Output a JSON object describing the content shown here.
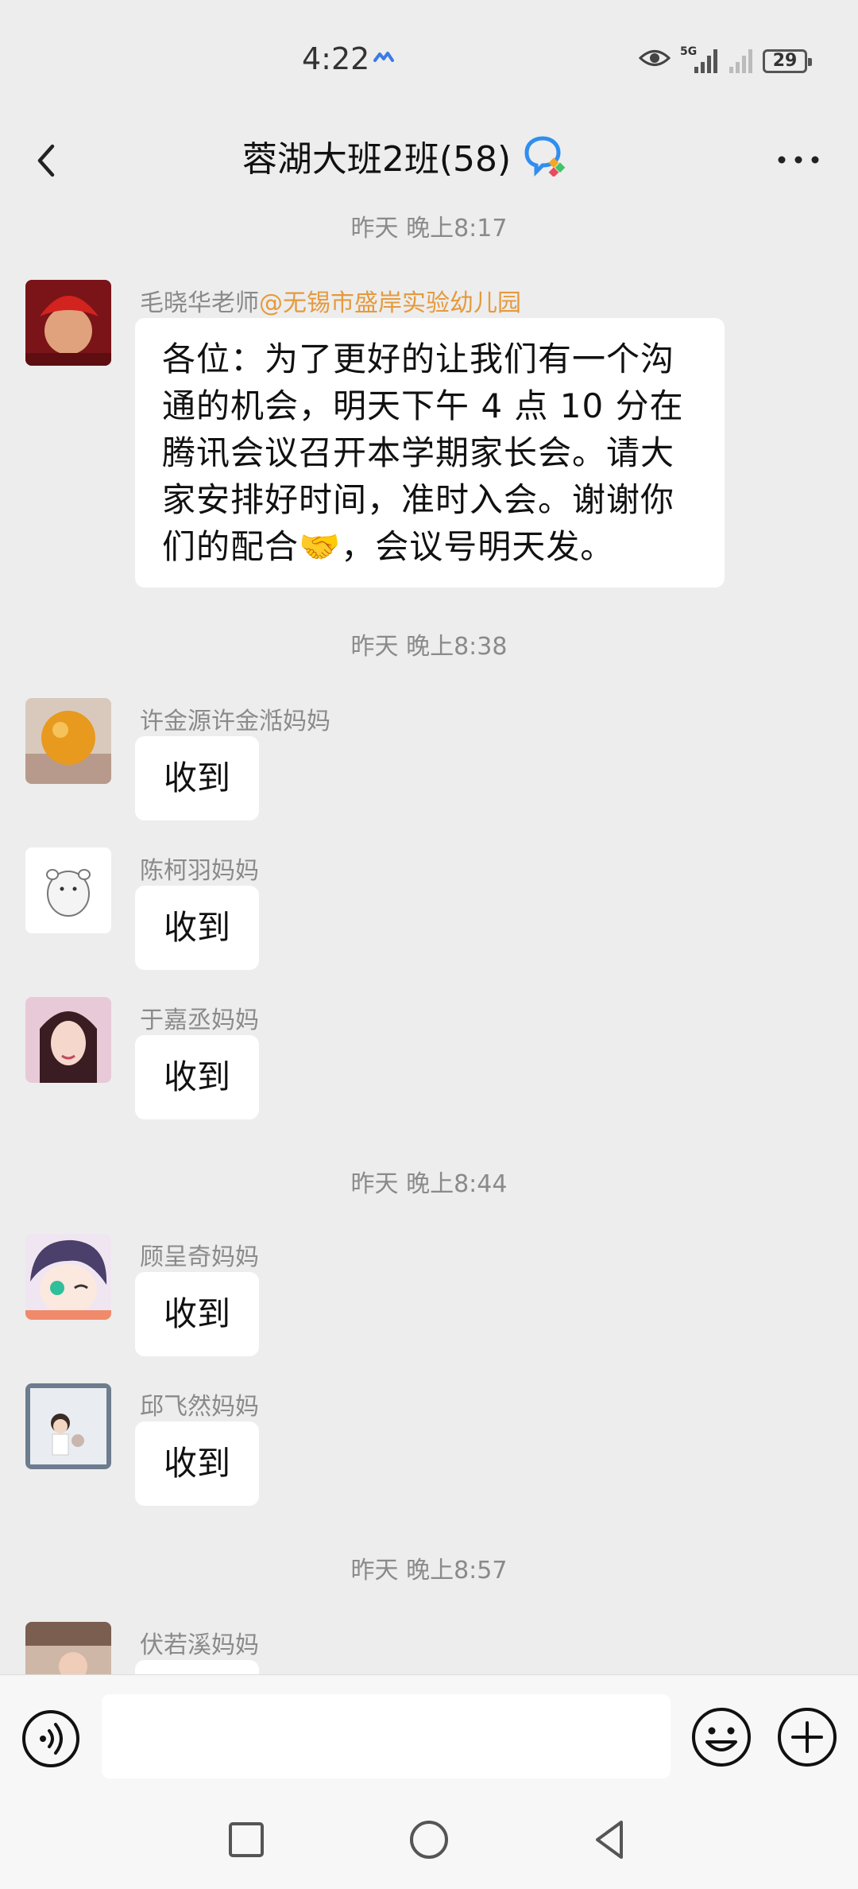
{
  "status_bar": {
    "time": "4:22",
    "network": "5G",
    "battery": "29"
  },
  "header": {
    "title": "蓉湖大班2班(58)"
  },
  "messages": [
    {
      "type": "time",
      "text": "昨天 晚上8:17"
    },
    {
      "type": "msg",
      "sender": "毛晓华老师",
      "mention": "@无锡市盛岸实验幼儿园",
      "lines": [
        "各位：为了更好的让我们有一个沟",
        "通的机会，明天下午 4 点 10 分在",
        "腾讯会议召开本学期家长会。请大",
        "家安排好时间，准时入会。谢谢你",
        "们的配合🤝，会议号明天发。"
      ]
    },
    {
      "type": "time",
      "text": "昨天 晚上8:38"
    },
    {
      "type": "msg",
      "sender": "许金源许金湉妈妈",
      "text": "收到"
    },
    {
      "type": "msg",
      "sender": "陈柯羽妈妈",
      "text": "收到"
    },
    {
      "type": "msg",
      "sender": "于嘉丞妈妈",
      "text": "收到"
    },
    {
      "type": "time",
      "text": "昨天 晚上8:44"
    },
    {
      "type": "msg",
      "sender": "顾呈奇妈妈",
      "text": "收到"
    },
    {
      "type": "msg",
      "sender": "邱飞然妈妈",
      "text": "收到"
    },
    {
      "type": "time",
      "text": "昨天 晚上8:57"
    },
    {
      "type": "msg",
      "sender": "伏若溪妈妈",
      "text": ""
    }
  ],
  "input": {
    "value": "",
    "placeholder": ""
  },
  "icons": {
    "back": "chevron-left-icon",
    "more": "more-dots-icon",
    "group_badge": "chat-bubbles-icon",
    "voice": "voice-icon",
    "emoji": "emoji-icon",
    "plus": "plus-icon",
    "recents": "square-icon",
    "home": "circle-icon",
    "back_nav": "triangle-back-icon"
  },
  "colors": {
    "background": "#ededed",
    "mention": "#e59a3d",
    "time_text": "#8a8a8a",
    "bubble": "#ffffff"
  }
}
